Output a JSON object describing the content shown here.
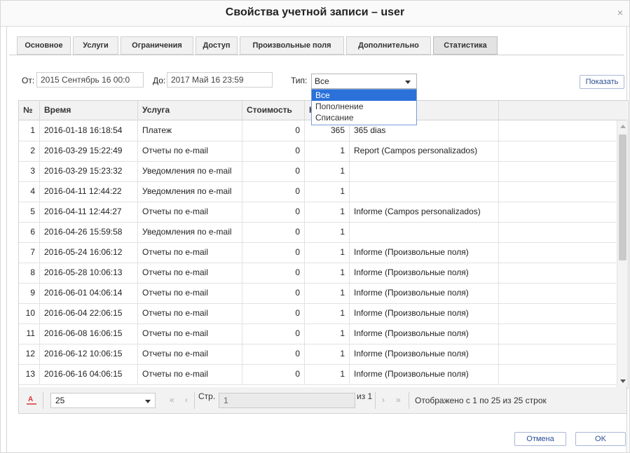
{
  "dialog": {
    "title": "Свойства учетной записи – user"
  },
  "tabs": [
    {
      "label": "Основное"
    },
    {
      "label": "Услуги"
    },
    {
      "label": "Ограничения"
    },
    {
      "label": "Доступ"
    },
    {
      "label": "Произвольные поля"
    },
    {
      "label": "Дополнительно"
    },
    {
      "label": "Статистика"
    }
  ],
  "active_tab": "Статистика",
  "filter": {
    "from_label": "От:",
    "from_value": "2015 Сентябрь 16 00:0",
    "to_label": "До:",
    "to_value": "2017 Май 16 23:59",
    "type_label": "Тип:",
    "type_value": "Все",
    "type_options": [
      "Все",
      "Пополнение",
      "Списание"
    ],
    "show_button": "Показать"
  },
  "table": {
    "columns": [
      "№",
      "Время",
      "Услуга",
      "Стоимость",
      "К"
    ],
    "rows": [
      [
        "1",
        "2016-01-18 16:18:54",
        "Платеж",
        "0",
        "365",
        "365 dias"
      ],
      [
        "2",
        "2016-03-29 15:22:49",
        "Отчеты по e-mail",
        "0",
        "1",
        "Report (Campos personalizados)"
      ],
      [
        "3",
        "2016-03-29 15:23:32",
        "Уведомления по e-mail",
        "0",
        "1",
        ""
      ],
      [
        "4",
        "2016-04-11 12:44:22",
        "Уведомления по e-mail",
        "0",
        "1",
        ""
      ],
      [
        "5",
        "2016-04-11 12:44:27",
        "Отчеты по e-mail",
        "0",
        "1",
        "Informe (Campos personalizados)"
      ],
      [
        "6",
        "2016-04-26 15:59:58",
        "Уведомления по e-mail",
        "0",
        "1",
        ""
      ],
      [
        "7",
        "2016-05-24 16:06:12",
        "Отчеты по e-mail",
        "0",
        "1",
        "Informe (Произвольные поля)"
      ],
      [
        "8",
        "2016-05-28 10:06:13",
        "Отчеты по e-mail",
        "0",
        "1",
        "Informe (Произвольные поля)"
      ],
      [
        "9",
        "2016-06-01 04:06:14",
        "Отчеты по e-mail",
        "0",
        "1",
        "Informe (Произвольные поля)"
      ],
      [
        "10",
        "2016-06-04 22:06:15",
        "Отчеты по e-mail",
        "0",
        "1",
        "Informe (Произвольные поля)"
      ],
      [
        "11",
        "2016-06-08 16:06:15",
        "Отчеты по e-mail",
        "0",
        "1",
        "Informe (Произвольные поля)"
      ],
      [
        "12",
        "2016-06-12 10:06:15",
        "Отчеты по e-mail",
        "0",
        "1",
        "Informe (Произвольные поля)"
      ],
      [
        "13",
        "2016-06-16 04:06:15",
        "Отчеты по e-mail",
        "0",
        "1",
        "Informe (Произвольные поля)"
      ]
    ]
  },
  "pager": {
    "page_size": "25",
    "page_label": "Стр.",
    "page_value": "1",
    "of_label": "из 1",
    "first_icon": "«",
    "prev_icon": "‹",
    "next_icon": "›",
    "last_icon": "»",
    "summary": "Отображено с 1 по 25 из 25 строк"
  },
  "buttons": {
    "cancel": "Отмена",
    "ok": "OK"
  },
  "colors": {
    "selected_option": "#2b71d9",
    "link_text": "#2a4f94"
  }
}
